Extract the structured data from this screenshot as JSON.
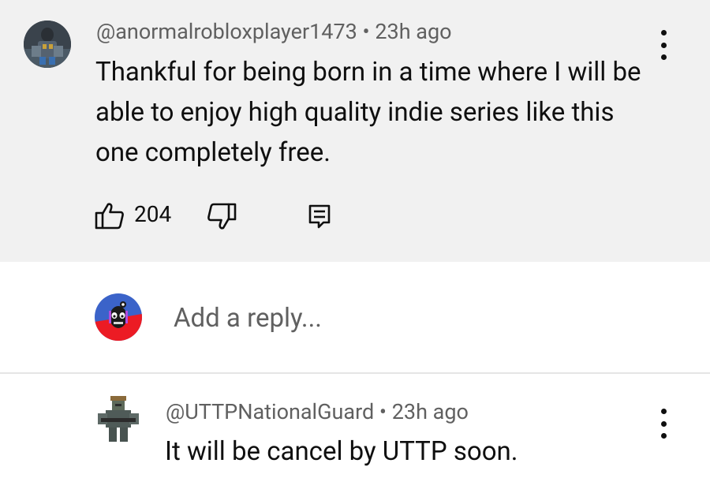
{
  "comment": {
    "author": "@anormalrobloxplayer1473",
    "separator": "•",
    "time": "23h ago",
    "text": "Thankful for being born in a time where I will be able to enjoy high quality indie series like this one completely free.",
    "like_count": "204",
    "icons": [
      "thumbs-up-icon",
      "thumbs-down-icon",
      "reply-icon",
      "more-vert-icon"
    ]
  },
  "reply_box": {
    "placeholder": "Add a reply..."
  },
  "reply": {
    "author": "@UTTPNationalGuard",
    "separator": "•",
    "time": "23h ago",
    "text": "It will be cancel by UTTP soon."
  },
  "colors": {
    "comment_bg": "#f1f1f1",
    "meta_text": "#606060",
    "primary_text": "#0f0f0f"
  }
}
